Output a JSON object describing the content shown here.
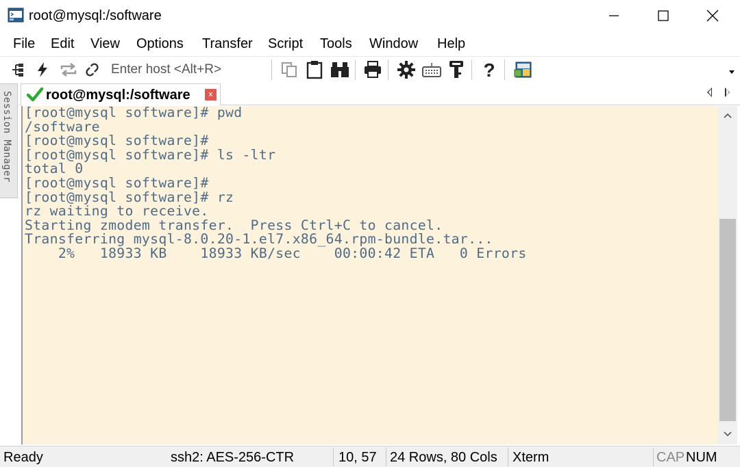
{
  "window": {
    "title": "root@mysql:/software",
    "icons": {
      "app": "securecrt-app-icon",
      "minimize": "minimize-icon",
      "maximize": "maximize-icon",
      "close": "close-icon"
    }
  },
  "menu": {
    "items": [
      "File",
      "Edit",
      "View",
      "Options",
      "Transfer",
      "Script",
      "Tools",
      "Window",
      "Help"
    ]
  },
  "toolbar": {
    "host_placeholder": "Enter host <Alt+R>",
    "icons": [
      "connect-tree-icon",
      "quick-connect-lightning-icon",
      "reconnect-icon",
      "disconnect-icon",
      "copy-icon",
      "paste-icon",
      "find-binoculars-icon",
      "print-icon",
      "session-options-gear-icon",
      "keymap-keyboard-icon",
      "key-icon",
      "help-icon",
      "sftp-icon"
    ]
  },
  "side_panel": {
    "label": "Session Manager"
  },
  "tab": {
    "label": "root@mysql:/software",
    "status_icon": "connected-check-icon",
    "close_label": "x"
  },
  "terminal": {
    "lines": [
      "[root@mysql software]# pwd",
      "/software",
      "[root@mysql software]#",
      "[root@mysql software]# ls -ltr",
      "total 0",
      "[root@mysql software]#",
      "[root@mysql software]# rz",
      "rz waiting to receive.",
      "Starting zmodem transfer.  Press Ctrl+C to cancel.",
      "Transferring mysql-8.0.20-1.el7.x86_64.rpm-bundle.tar...",
      "    2%   18933 KB    18933 KB/sec    00:00:42 ETA   0 Errors"
    ],
    "colors": {
      "background": "#fdf3dc",
      "foreground": "#4f6b88"
    }
  },
  "status": {
    "state": "Ready",
    "cipher": "ssh2: AES-256-CTR",
    "cursor": "10,  57",
    "size": "24 Rows, 80 Cols",
    "terminal_type": "Xterm",
    "cap": "CAP",
    "num": "NUM"
  }
}
